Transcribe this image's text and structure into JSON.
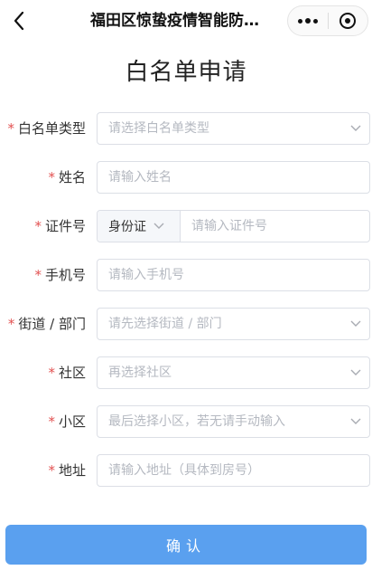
{
  "navbar": {
    "title": "福田区惊蛰疫情智能防…",
    "back_icon": "chevron-left-icon",
    "more_icon": "more-dots-icon",
    "close_icon": "target-circle-icon"
  },
  "page": {
    "title": "白名单申请"
  },
  "form": {
    "required_mark": "*",
    "fields": [
      {
        "label": "白名单类型",
        "placeholder": "请选择白名单类型"
      },
      {
        "label": "姓名",
        "placeholder": "请输入姓名"
      },
      {
        "label": "证件号",
        "id_type": "身份证",
        "placeholder": "请输入证件号"
      },
      {
        "label": "手机号",
        "placeholder": "请输入手机号"
      },
      {
        "label": "街道 / 部门",
        "placeholder": "请先选择街道 / 部门"
      },
      {
        "label": "社区",
        "placeholder": "再选择社区"
      },
      {
        "label": "小区",
        "placeholder": "最后选择小区，若无请手动输入"
      },
      {
        "label": "地址",
        "placeholder": "请输入地址（具体到房号）"
      }
    ]
  },
  "submit": {
    "label": "确认"
  },
  "colors": {
    "required": "#e25151",
    "primary_button": "#5aa0ef",
    "border": "#dcdfe6",
    "placeholder": "#b5b9c1"
  }
}
